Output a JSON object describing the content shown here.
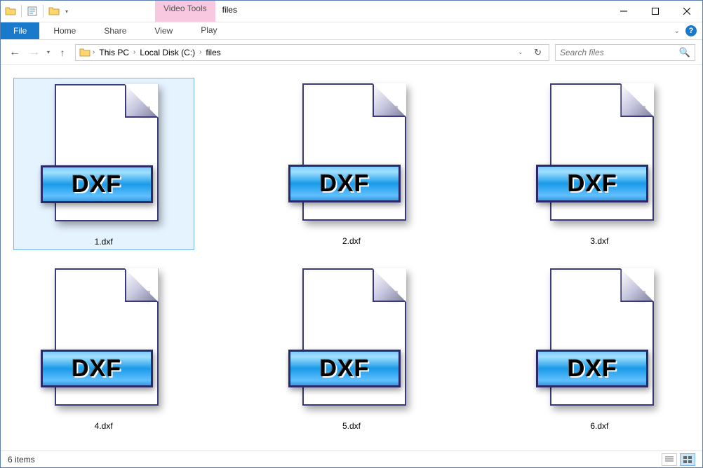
{
  "window": {
    "title": "files",
    "video_tools_label": "Video Tools"
  },
  "ribbon": {
    "file": "File",
    "tabs": [
      "Home",
      "Share",
      "View"
    ],
    "play": "Play"
  },
  "breadcrumbs": [
    "This PC",
    "Local Disk (C:)",
    "files"
  ],
  "search": {
    "placeholder": "Search files"
  },
  "files": [
    {
      "name": "1.dxf",
      "badge": "DXF",
      "selected": true
    },
    {
      "name": "2.dxf",
      "badge": "DXF",
      "selected": false
    },
    {
      "name": "3.dxf",
      "badge": "DXF",
      "selected": false
    },
    {
      "name": "4.dxf",
      "badge": "DXF",
      "selected": false
    },
    {
      "name": "5.dxf",
      "badge": "DXF",
      "selected": false
    },
    {
      "name": "6.dxf",
      "badge": "DXF",
      "selected": false
    }
  ],
  "status": {
    "count_text": "6 items"
  }
}
